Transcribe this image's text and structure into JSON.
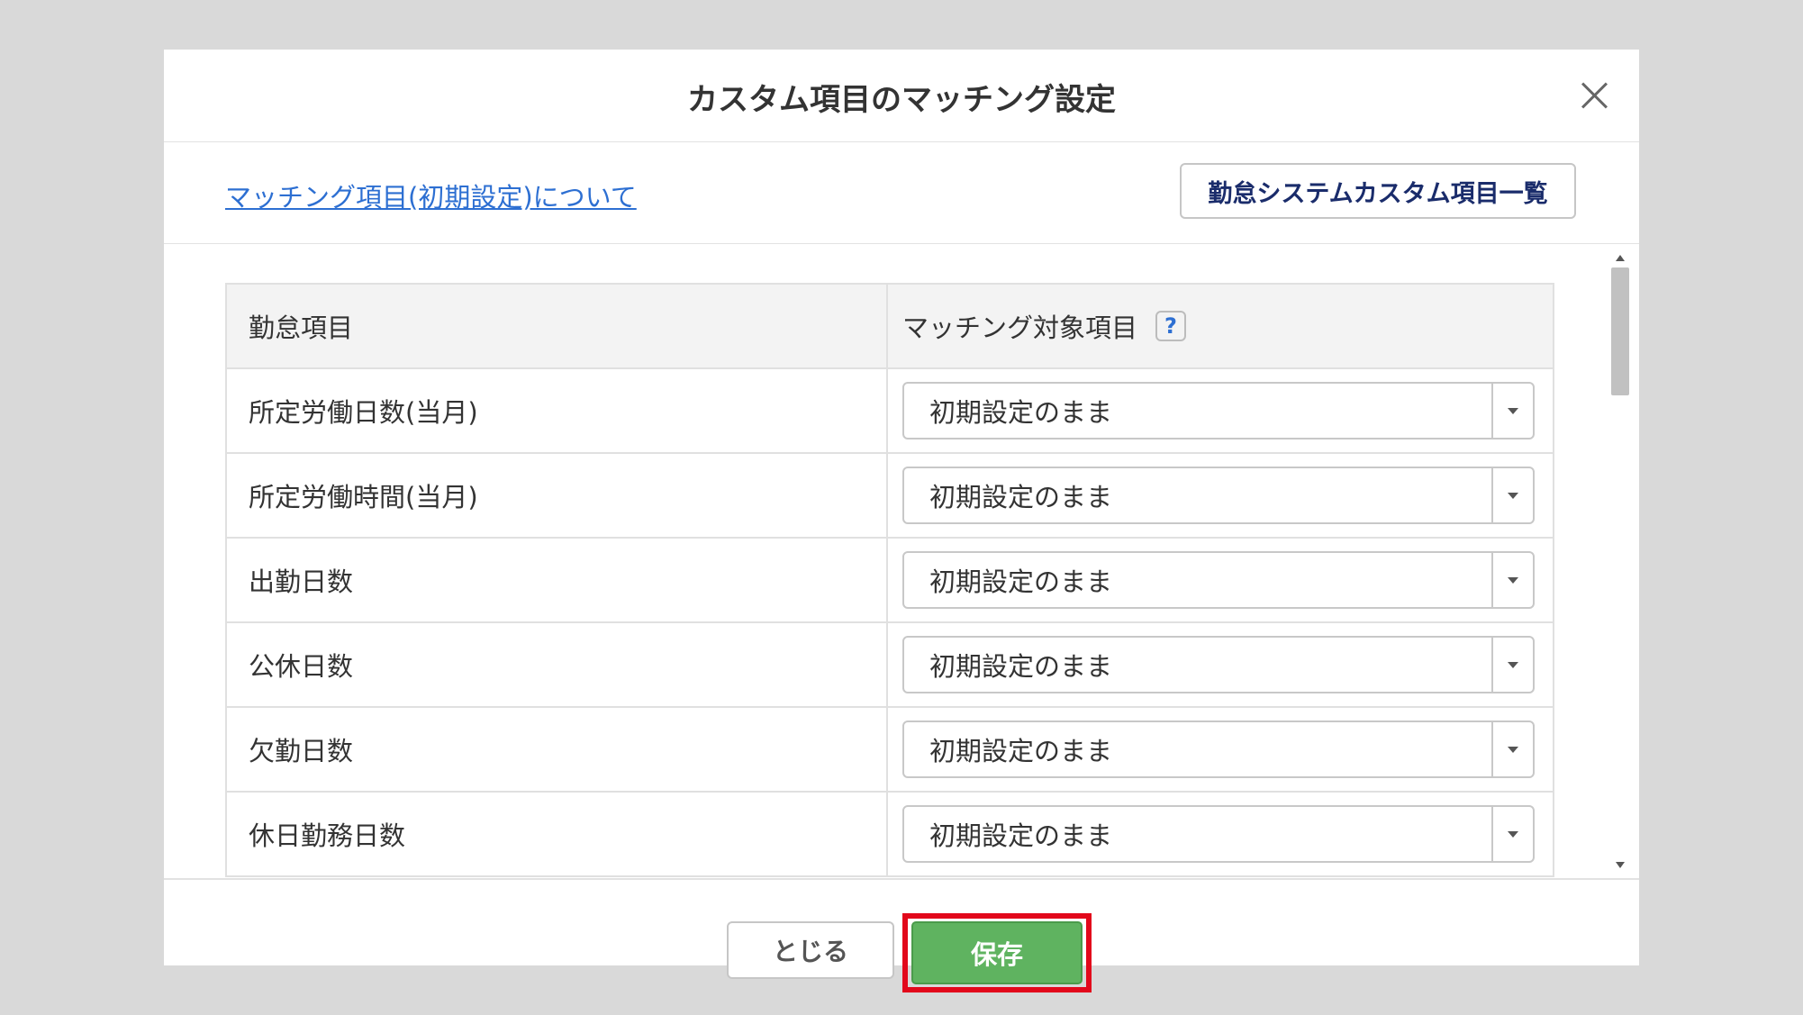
{
  "modal": {
    "title": "カスタム項目のマッチング設定"
  },
  "subheader": {
    "help_link": "マッチング項目(初期設定)について",
    "custom_list_button": "勤怠システムカスタム項目一覧"
  },
  "table": {
    "header_left": "勤怠項目",
    "header_right": "マッチング対象項目",
    "help_icon": "?",
    "rows": [
      {
        "label": "所定労働日数(当月)",
        "value": "初期設定のまま"
      },
      {
        "label": "所定労働時間(当月)",
        "value": "初期設定のまま"
      },
      {
        "label": "出勤日数",
        "value": "初期設定のまま"
      },
      {
        "label": "公休日数",
        "value": "初期設定のまま"
      },
      {
        "label": "欠勤日数",
        "value": "初期設定のまま"
      },
      {
        "label": "休日勤務日数",
        "value": "初期設定のまま"
      }
    ]
  },
  "footer": {
    "close_label": "とじる",
    "save_label": "保存"
  },
  "colors": {
    "save_green": "#5fb360",
    "highlight_red": "#e2081b",
    "link_blue": "#2d6fd2"
  },
  "icons": [
    "close-icon",
    "question-icon",
    "chevron-down-icon"
  ]
}
